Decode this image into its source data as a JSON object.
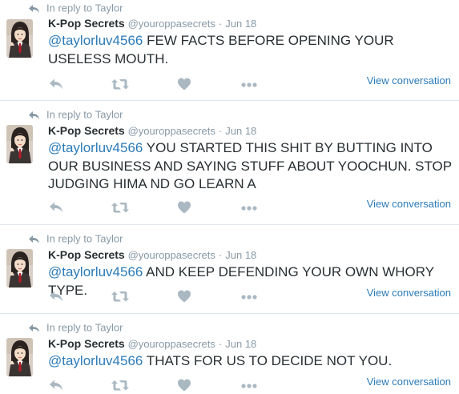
{
  "colors": {
    "text": "#292f33",
    "muted": "#8899a6",
    "link": "#2b7bb9",
    "icon": "#aab8c2",
    "divider": "#e1e8ed"
  },
  "tweets": [
    {
      "reply_prefix": "In reply to",
      "reply_to": "Taylor",
      "fullname": "K-Pop Secrets",
      "username": "@youroppasecrets",
      "separator": "·",
      "date": "Jun 18",
      "mention": "@taylorluv4566",
      "text": " FEW FACTS BEFORE OPENING YOUR USELESS MOUTH.",
      "view_conversation": "View conversation",
      "icons": [
        "reply-icon",
        "retweet-icon",
        "heart-icon",
        "more-icon"
      ]
    },
    {
      "reply_prefix": "In reply to",
      "reply_to": "Taylor",
      "fullname": "K-Pop Secrets",
      "username": "@youroppasecrets",
      "separator": "·",
      "date": "Jun 18",
      "mention": "@taylorluv4566",
      "text": " YOU STARTED THIS SHIT BY BUTTING INTO OUR BUSINESS AND SAYING STUFF ABOUT YOOCHUN. STOP JUDGING HIMA ND GO LEARN A",
      "view_conversation": "View conversation",
      "icons": [
        "reply-icon",
        "retweet-icon",
        "heart-icon",
        "more-icon"
      ]
    },
    {
      "reply_prefix": "In reply to",
      "reply_to": "Taylor",
      "fullname": "K-Pop Secrets",
      "username": "@youroppasecrets",
      "separator": "·",
      "date": "Jun 18",
      "mention": "@taylorluv4566",
      "text": " AND KEEP DEFENDING YOUR OWN WHORY TYPE.",
      "view_conversation": "View conversation",
      "icons": [
        "reply-icon",
        "retweet-icon",
        "heart-icon",
        "more-icon"
      ]
    },
    {
      "reply_prefix": "In reply to",
      "reply_to": "Taylor",
      "fullname": "K-Pop Secrets",
      "username": "@youroppasecrets",
      "separator": "·",
      "date": "Jun 18",
      "mention": "@taylorluv4566",
      "text": " THATS FOR US TO DECIDE NOT YOU.",
      "view_conversation": "View conversation",
      "icons": [
        "reply-icon",
        "retweet-icon",
        "heart-icon",
        "more-icon"
      ]
    }
  ]
}
